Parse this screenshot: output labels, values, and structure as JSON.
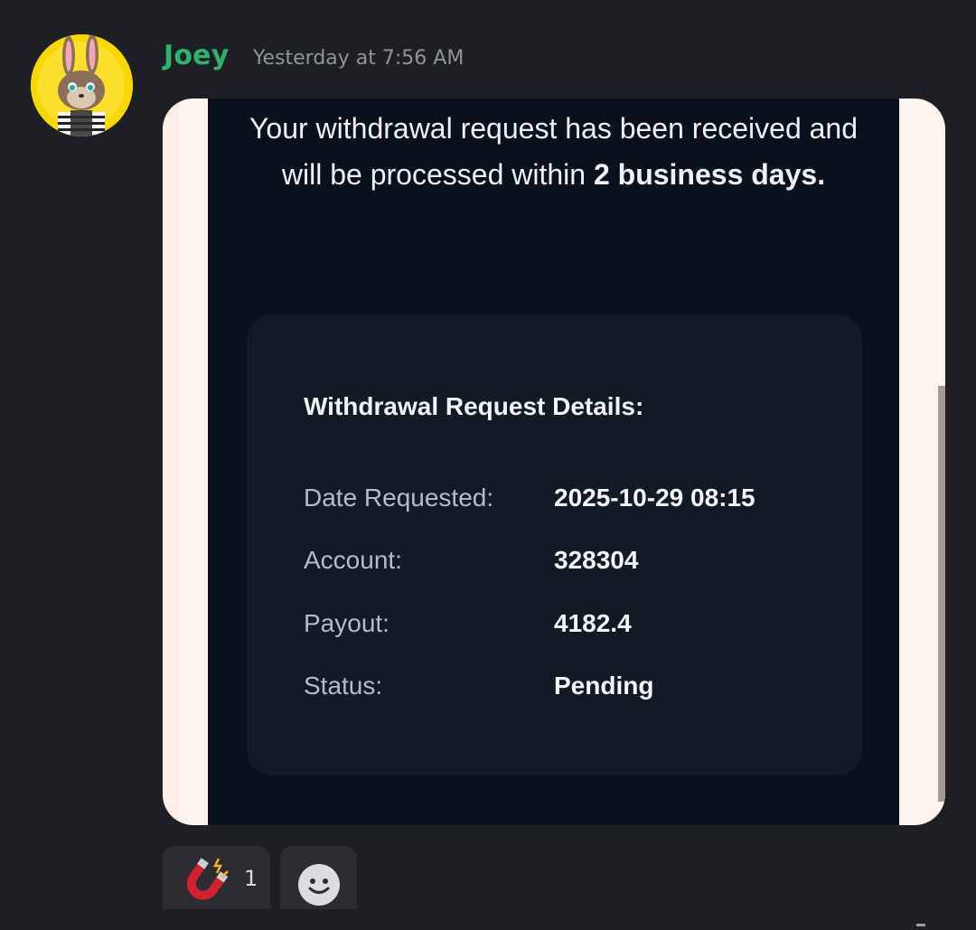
{
  "message": {
    "author": "Joey",
    "timestamp": "Yesterday at 7:56 AM",
    "avatar_icon": "rabbit-avatar-icon"
  },
  "attachment": {
    "text_part1": "Your withdrawal request has been received and will be processed within ",
    "text_bold": "2 business days.",
    "card": {
      "title": "Withdrawal Request Details:",
      "rows": [
        {
          "label": "Date Requested:",
          "value": "2025-10-29 08:15"
        },
        {
          "label": "Account:",
          "value": "328304"
        },
        {
          "label": "Payout:",
          "value": "4182.4"
        },
        {
          "label": "Status:",
          "value": "Pending"
        }
      ]
    }
  },
  "reactions": [
    {
      "icon": "magnet-icon",
      "count": "1"
    },
    {
      "icon": "add-reaction-icon"
    }
  ],
  "colors": {
    "username": "#2fb36a",
    "background": "#1e1f24",
    "screen": "#0a111c",
    "card": "#111a25"
  }
}
